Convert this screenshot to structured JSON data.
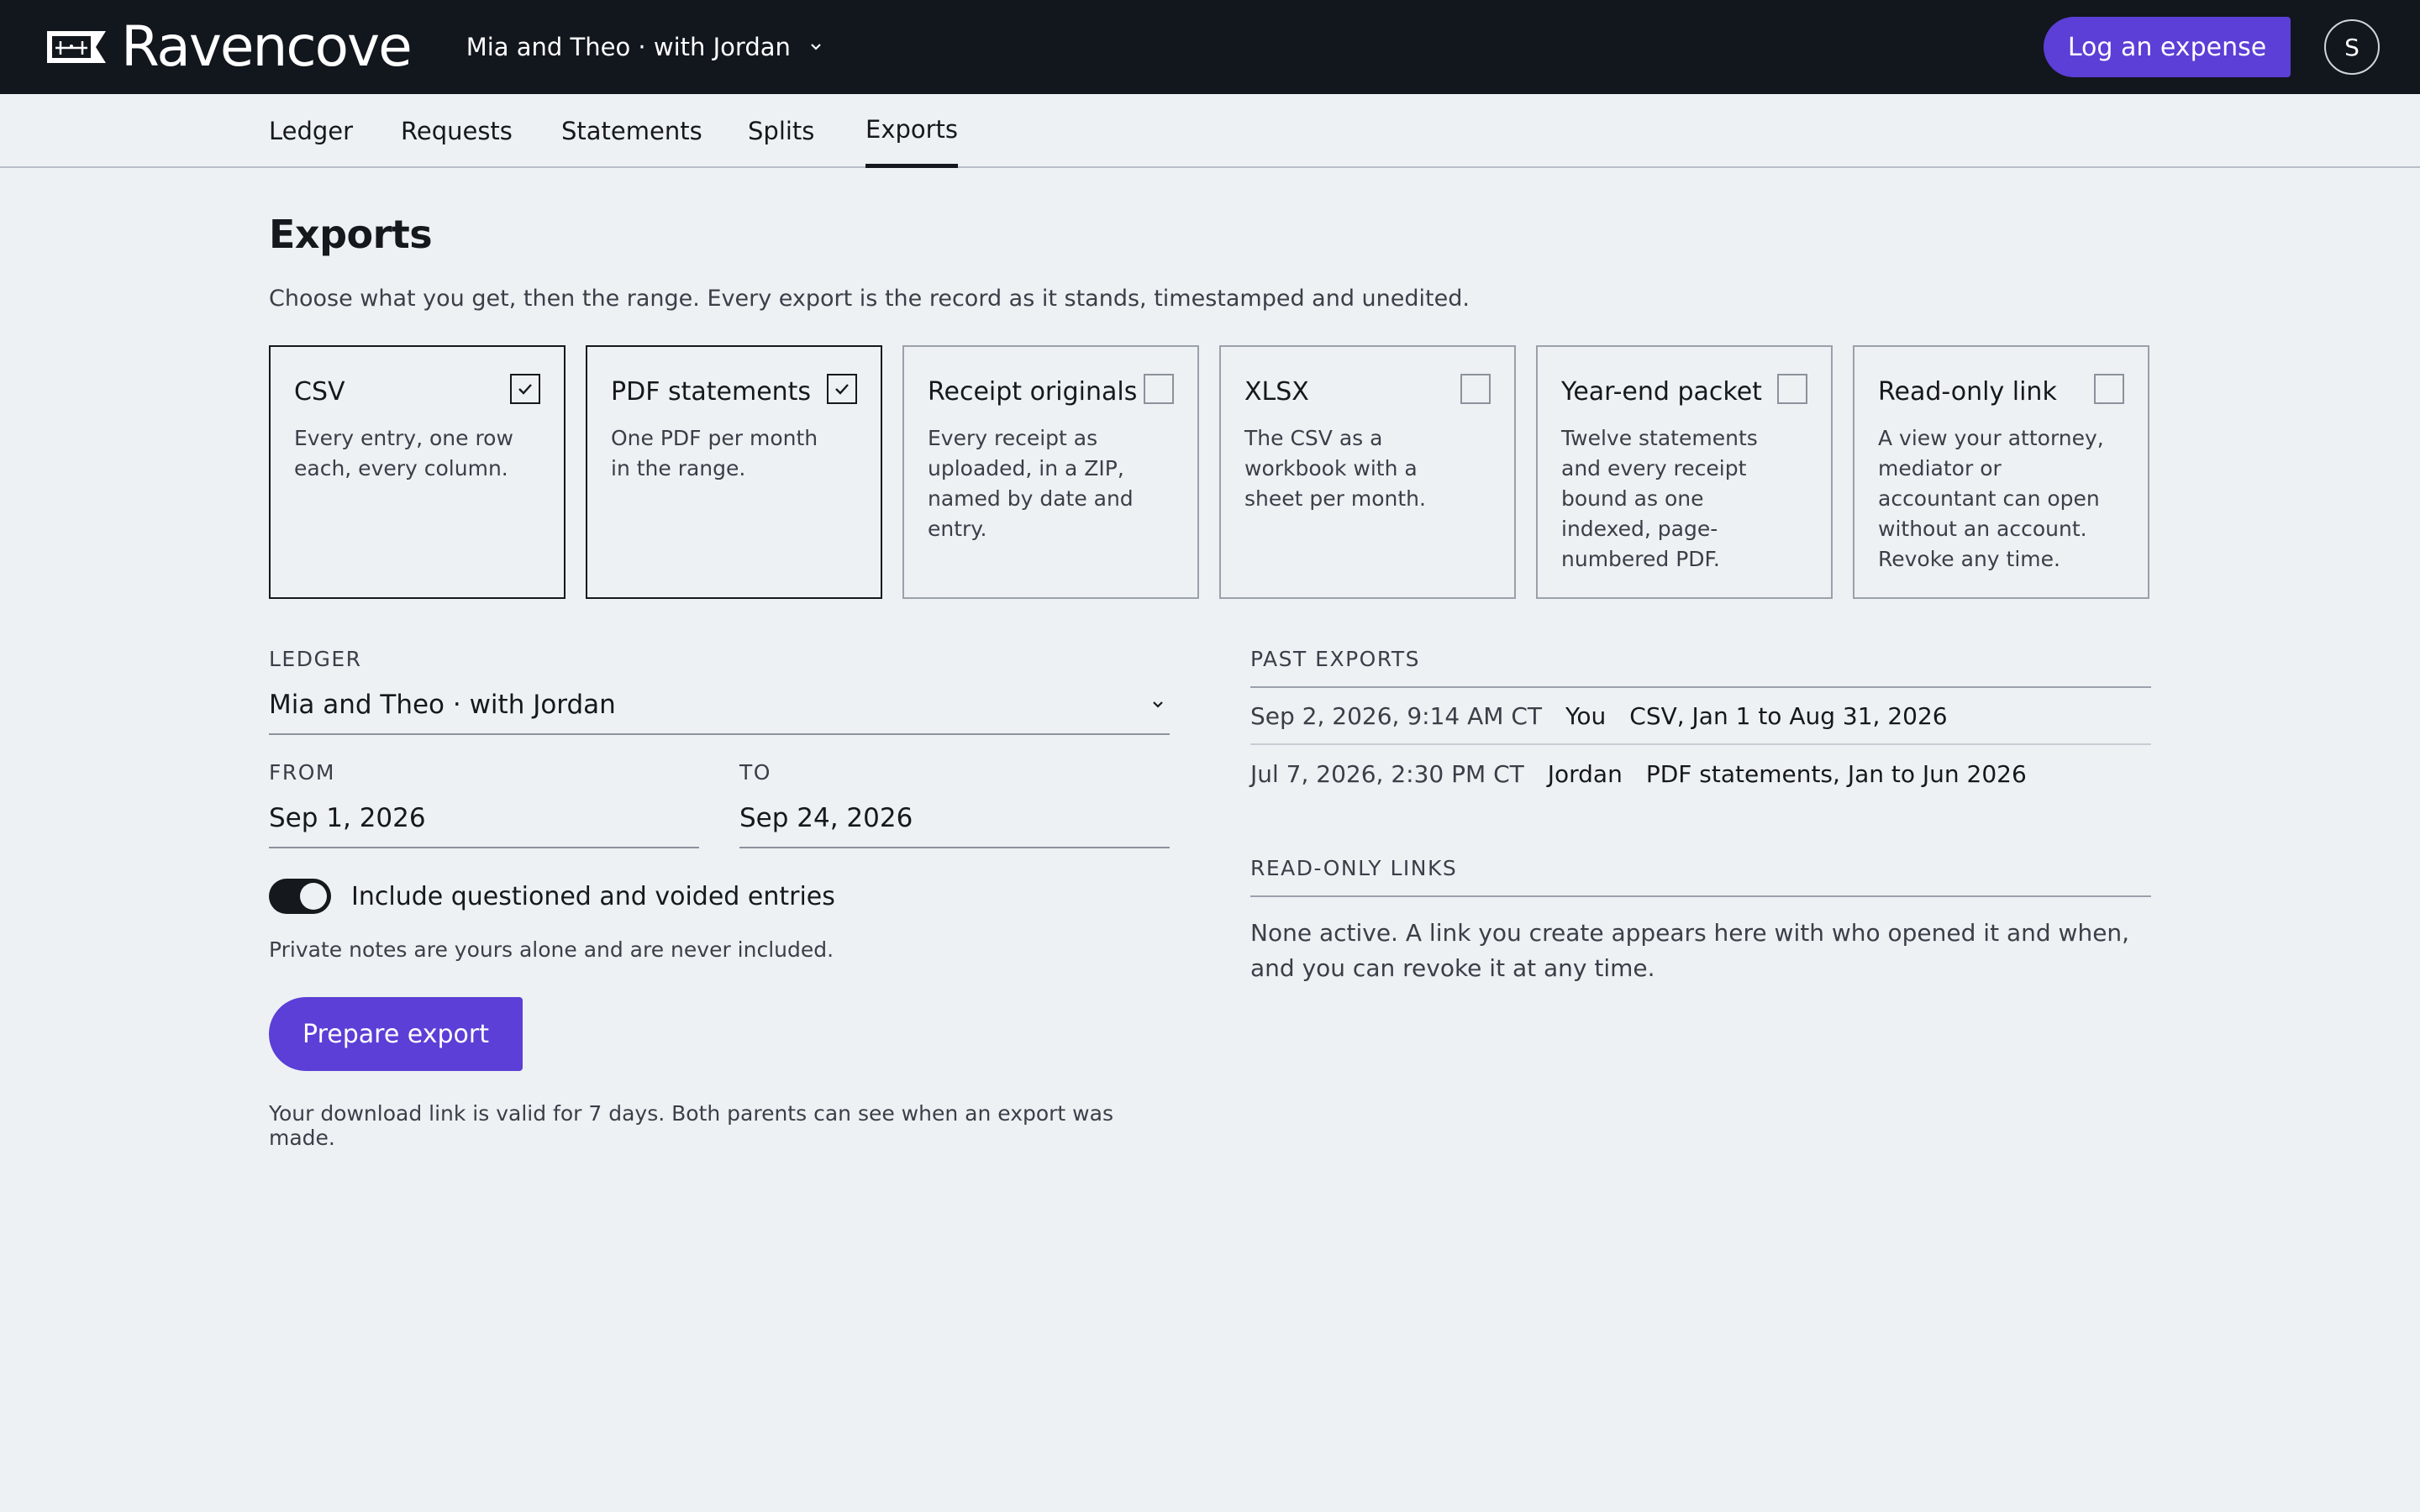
{
  "app": {
    "name": "Ravencove"
  },
  "header": {
    "ledger_switcher": "Mia and Theo · with Jordan",
    "log_expense_button": "Log an expense",
    "avatar_initial": "S"
  },
  "tabs": [
    {
      "label": "Ledger"
    },
    {
      "label": "Requests"
    },
    {
      "label": "Statements"
    },
    {
      "label": "Splits"
    },
    {
      "label": "Exports",
      "active": true
    }
  ],
  "page": {
    "title": "Exports",
    "subtitle": "Choose what you get, then the range. Every export is the record as it stands, timestamped and unedited."
  },
  "formats": [
    {
      "title": "CSV",
      "desc": "Every entry, one row each, every column.",
      "selected": true
    },
    {
      "title": "PDF statements",
      "desc": "One PDF per month in the range.",
      "selected": true
    },
    {
      "title": "Receipt originals",
      "desc": "Every receipt as uploaded, in a ZIP, named by date and entry.",
      "selected": false
    },
    {
      "title": "XLSX",
      "desc": "The CSV as a workbook with a sheet per month.",
      "selected": false
    },
    {
      "title": "Year-end packet",
      "desc": "Twelve statements and every receipt bound as one indexed, page-numbered PDF.",
      "selected": false
    },
    {
      "title": "Read-only link",
      "desc": "A view your attorney, mediator or accountant can open without an account. Revoke any time.",
      "selected": false
    }
  ],
  "form": {
    "ledger_label": "LEDGER",
    "ledger_value": "Mia and Theo · with Jordan",
    "from_label": "FROM",
    "from_value": "Sep 1, 2026",
    "to_label": "TO",
    "to_value": "Sep 24, 2026",
    "toggle_label": "Include questioned and voided entries",
    "toggle_on": true,
    "privacy_hint": "Private notes are yours alone and are never included.",
    "prepare_button": "Prepare export",
    "download_hint": "Your download link is valid for 7 days. Both parents can see when an export was made."
  },
  "past_exports": {
    "label": "PAST EXPORTS",
    "rows": [
      {
        "time": "Sep 2, 2026, 9:14 AM CT",
        "who": "You",
        "what": "CSV, Jan 1 to Aug 31, 2026"
      },
      {
        "time": "Jul 7, 2026, 2:30 PM CT",
        "who": "Jordan",
        "what": "PDF statements, Jan to Jun 2026"
      }
    ]
  },
  "read_only_links": {
    "label": "READ-ONLY LINKS",
    "text": "None active. A link you create appears here with who opened it and when, and you can revoke it at any time."
  },
  "colors": {
    "accent": "#5b3fd6",
    "topbar": "#12161d",
    "background": "#eef1f4"
  }
}
